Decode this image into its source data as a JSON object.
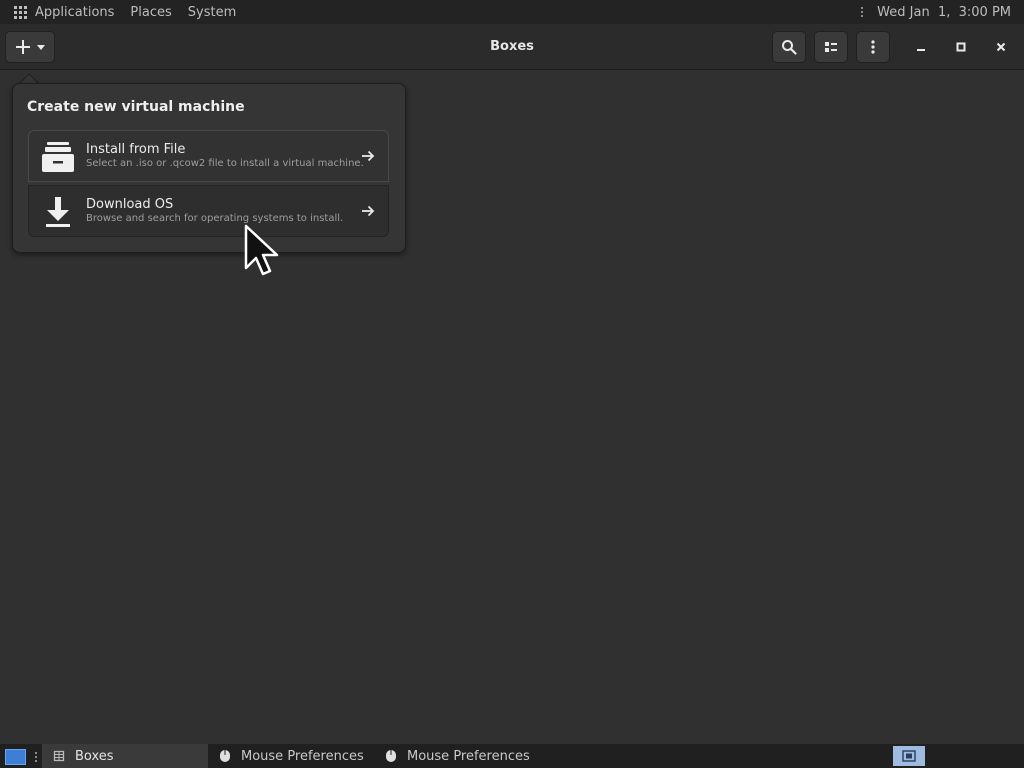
{
  "top_panel": {
    "menu": [
      "Applications",
      "Places",
      "System"
    ],
    "clock": "Wed Jan  1,  3:00 PM"
  },
  "headerbar": {
    "title": "Boxes",
    "new_button_icon": "plus-icon",
    "search_icon": "search-icon",
    "view_icon": "list-view-icon",
    "menu_icon": "kebab-menu-icon"
  },
  "popover": {
    "heading": "Create new virtual machine",
    "options": [
      {
        "title": "Install from File",
        "subtitle": "Select an .iso or .qcow2 file to install a virtual machine.",
        "icon": "file-cabinet-icon"
      },
      {
        "title": "Download OS",
        "subtitle": "Browse and search for operating systems to install.",
        "icon": "download-icon"
      }
    ]
  },
  "taskbar": {
    "tasks": [
      {
        "label": "Boxes",
        "icon": "boxes-icon",
        "active": true
      },
      {
        "label": "Mouse Preferences",
        "icon": "mouse-icon",
        "active": false
      },
      {
        "label": "Mouse Preferences",
        "icon": "mouse-icon",
        "active": false
      }
    ]
  },
  "colors": {
    "background": "#303030",
    "panel": "#232323",
    "accent": "#3d7fd6"
  }
}
